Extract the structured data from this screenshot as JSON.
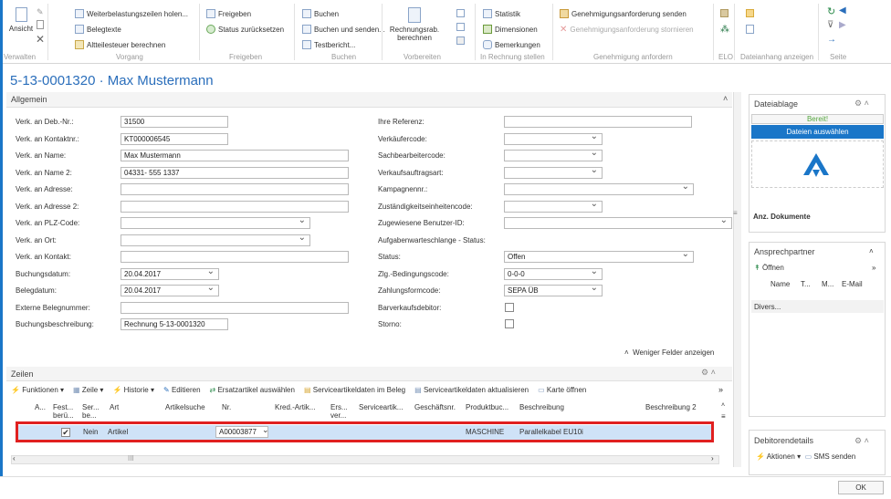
{
  "ribbon": {
    "ansicht": "Ansicht",
    "weiterbelastung": "Weiterbelastungszeilen holen...",
    "belegtexte": "Belegtexte",
    "altteilesteuer": "Altteilesteuer berechnen",
    "freigeben": "Freigeben",
    "status_zurueck": "Status zurücksetzen",
    "buchen": "Buchen",
    "buchen_senden": "Buchen und senden...",
    "testbericht": "Testbericht...",
    "rechnungsrab": "Rechnungsrab. berechnen",
    "statistik": "Statistik",
    "dimensionen": "Dimensionen",
    "bemerkungen": "Bemerkungen",
    "gen_senden": "Genehmigungsanforderung senden",
    "gen_stornieren": "Genehmigungsanforderung stornieren",
    "groups": {
      "verwalten": "Verwalten",
      "vorgang": "Vorgang",
      "freigeben": "Freigeben",
      "buchen": "Buchen",
      "vorbereiten": "Vorbereiten",
      "in_rechnung": "In Rechnung stellen",
      "genehmigung": "Genehmigung anfordern",
      "elo": "ELO",
      "dateianhang": "Dateianhang anzeigen",
      "seite": "Seite"
    }
  },
  "page_title": "5-13-0001320 · Max Mustermann",
  "allgemein": {
    "header": "Allgemein",
    "left": [
      {
        "label": "Verk. an Deb.-Nr.:",
        "value": "31500",
        "dd": false
      },
      {
        "label": "Verk. an Kontaktnr.:",
        "value": "KT000006545",
        "dd": false
      },
      {
        "label": "Verk. an Name:",
        "value": "Max Mustermann",
        "dd": false
      },
      {
        "label": "Verk. an Name 2:",
        "value": "04331- 555 1337",
        "dd": false
      },
      {
        "label": "Verk. an Adresse:",
        "value": "",
        "dd": false
      },
      {
        "label": "Verk. an Adresse 2:",
        "value": "",
        "dd": false
      },
      {
        "label": "Verk. an PLZ-Code:",
        "value": "",
        "dd": true
      },
      {
        "label": "Verk. an Ort:",
        "value": "",
        "dd": true
      },
      {
        "label": "Verk. an Kontakt:",
        "value": "",
        "dd": false
      },
      {
        "label": "Buchungsdatum:",
        "value": "20.04.2017",
        "dd": true
      },
      {
        "label": "Belegdatum:",
        "value": "20.04.2017",
        "dd": true
      },
      {
        "label": "Externe Belegnummer:",
        "value": "",
        "dd": false
      },
      {
        "label": "Buchungsbeschreibung:",
        "value": "Rechnung 5-13-0001320",
        "dd": false
      }
    ],
    "right": [
      {
        "label": "Ihre Referenz:",
        "value": ""
      },
      {
        "label": "Verkäufercode:",
        "value": ""
      },
      {
        "label": "Sachbearbeitercode:",
        "value": ""
      },
      {
        "label": "Verkaufsauftragsart:",
        "value": ""
      },
      {
        "label": "Kampagnennr.:",
        "value": ""
      },
      {
        "label": "Zuständigkeitseinheitencode:",
        "value": ""
      },
      {
        "label": "Zugewiesene Benutzer-ID:",
        "value": ""
      },
      {
        "label": "Aufgabenwarteschlange - Status:",
        "value": ""
      },
      {
        "label": "Status:",
        "value": "Offen"
      },
      {
        "label": "Zlg.-Bedingungscode:",
        "value": "0-0-0"
      },
      {
        "label": "Zahlungsformcode:",
        "value": "SEPA ÜB"
      },
      {
        "label": "Barverkaufsdebitor:",
        "value": ""
      },
      {
        "label": "Storno:",
        "value": ""
      }
    ],
    "weniger": "Weniger Felder anzeigen"
  },
  "zeilen": {
    "header": "Zeilen",
    "toolbar": [
      "Funktionen",
      "Zeile",
      "Historie",
      "Editieren",
      "Ersatzartikel auswählen",
      "Serviceartikeldaten im Beleg",
      "Serviceartikeldaten aktualisieren",
      "Karte öffnen"
    ],
    "columns": [
      "A...",
      "Fest... berü...",
      "Ser... be...",
      "Art",
      "Artikelsuche",
      "Nr.",
      "Kred.-Artik...",
      "Ers... ver...",
      "Serviceartik...",
      "Geschäftsnr.",
      "Produktbuc...",
      "Beschreibung",
      "Beschreibung 2"
    ],
    "row": {
      "check": "✔",
      "nein": "Nein",
      "art": "Artikel",
      "nr": "A00003877",
      "produkt": "MASCHINE",
      "beschreibung": "Parallelkabel EU10i"
    },
    "highlight_color": "#e02020"
  },
  "side": {
    "dateiablage": "Dateiablage",
    "bereit": "Bereit!",
    "dateien_auswaehlen": "Dateien auswählen",
    "anz_dokumente": "Anz. Dokumente",
    "ansprechpartner": "Ansprechpartner",
    "oeffnen": "Öffnen",
    "cols": [
      "Name",
      "T...",
      "M...",
      "E-Mail"
    ],
    "divers": "Divers...",
    "debitorendetails": "Debitorendetails",
    "aktionen": "Aktionen",
    "sms": "SMS senden"
  },
  "ok": "OK",
  "colors": {
    "accent": "#1a76c8",
    "title": "#2a6ebb",
    "highlight": "#e02020",
    "bereit": "#54a53e"
  }
}
